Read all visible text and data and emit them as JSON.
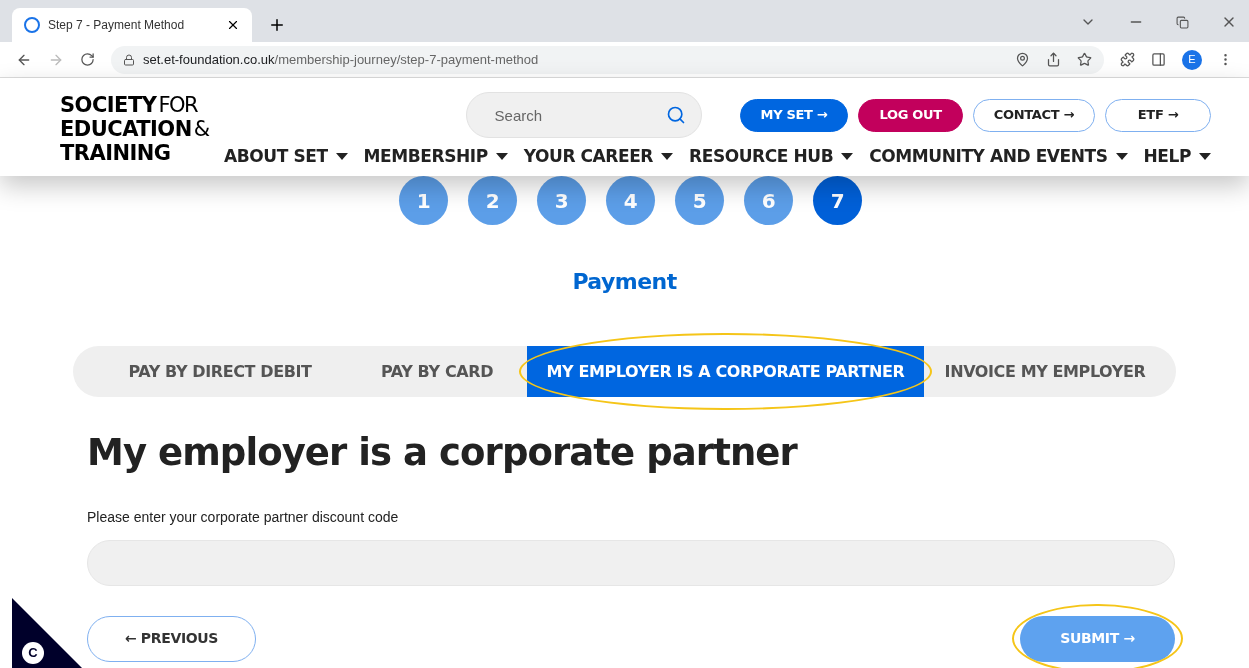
{
  "browser": {
    "tab_title": "Step 7 - Payment Method",
    "url_host": "set.et-foundation.co.uk",
    "url_path": "/membership-journey/step-7-payment-method",
    "profile_initial": "E"
  },
  "header": {
    "logo_lines": [
      {
        "bold": "SOCIETY",
        "light": "FOR"
      },
      {
        "bold": "EDUCATION",
        "light": "&"
      },
      {
        "bold": "TRAINING"
      }
    ],
    "search": {
      "placeholder": "Search"
    },
    "top_buttons": [
      {
        "label": "MY SET →",
        "kind": "primary"
      },
      {
        "label": "LOG OUT",
        "kind": "danger"
      },
      {
        "label": "CONTACT →",
        "kind": "outline"
      },
      {
        "label": "ETF →",
        "kind": "outline"
      }
    ],
    "nav": [
      "ABOUT SET",
      "MEMBERSHIP",
      "YOUR CAREER",
      "RESOURCE HUB",
      "COMMUNITY AND EVENTS",
      "HELP"
    ]
  },
  "steps": [
    {
      "label": "1",
      "selected": false
    },
    {
      "label": "2",
      "selected": false
    },
    {
      "label": "3",
      "selected": false
    },
    {
      "label": "4",
      "selected": false
    },
    {
      "label": "5",
      "selected": false
    },
    {
      "label": "6",
      "selected": false
    },
    {
      "label": "7",
      "selected": true
    }
  ],
  "section_title": "Payment",
  "payment_tabs": [
    {
      "label": "PAY BY DIRECT DEBIT",
      "selected": false,
      "highlighted": false
    },
    {
      "label": "PAY BY CARD",
      "selected": false,
      "highlighted": false
    },
    {
      "label": "MY EMPLOYER IS A CORPORATE PARTNER",
      "selected": true,
      "highlighted": true
    },
    {
      "label": "INVOICE MY EMPLOYER",
      "selected": false,
      "highlighted": false
    }
  ],
  "heading": "My employer is a corporate partner",
  "code_field": {
    "label": "Please enter your corporate partner discount code"
  },
  "previous_button": {
    "label": "← PREVIOUS"
  },
  "submit_button": {
    "label": "SUBMIT →",
    "disabled": true,
    "highlighted": true
  },
  "cookie_badge": {
    "letter": "C"
  }
}
